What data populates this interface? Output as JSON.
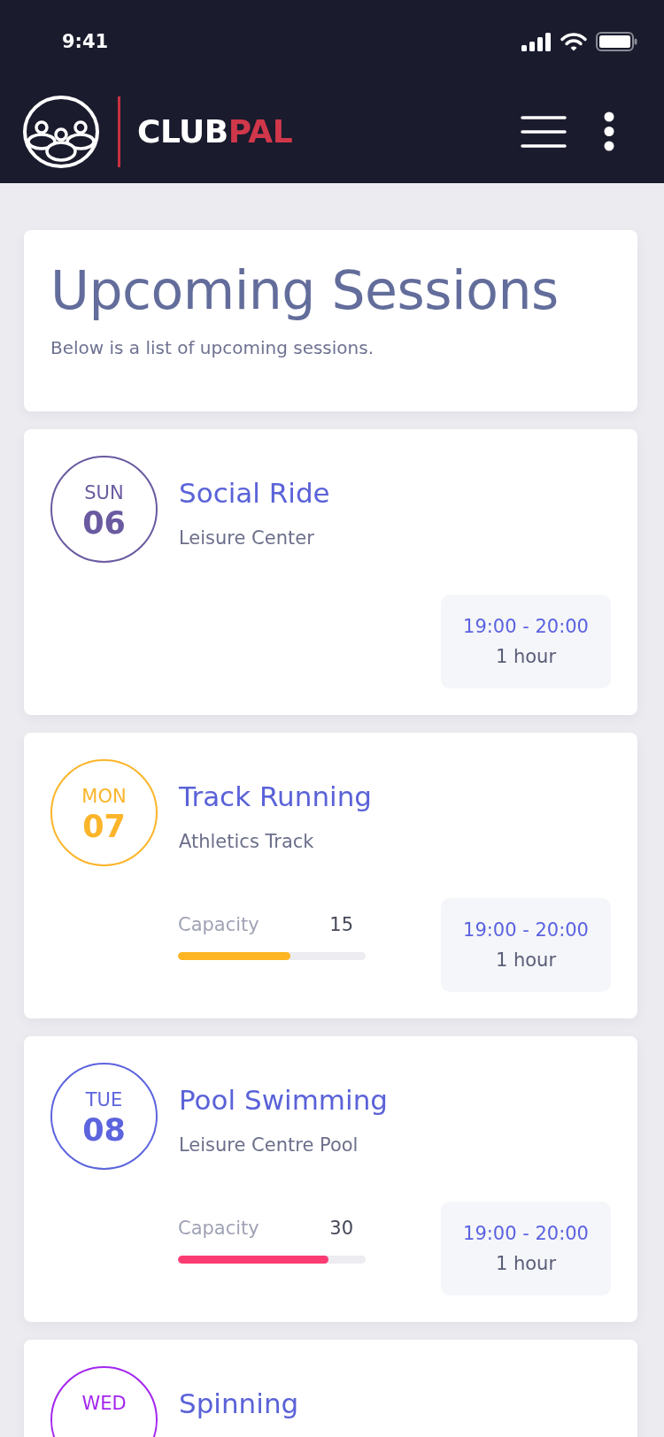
{
  "status_bar": {
    "time": "9:41"
  },
  "header": {
    "brand_main": "CLUB",
    "brand_accent": "PAL"
  },
  "page_header": {
    "title": "Upcoming Sessions",
    "subtitle": "Below is a list of upcoming sessions."
  },
  "sessions": [
    {
      "day": "SUN",
      "date": "06",
      "color": "#6a5aa0",
      "title": "Social Ride",
      "location": "Leisure Center",
      "time": "19:00 - 20:00",
      "duration": "1 hour"
    },
    {
      "day": "MON",
      "date": "07",
      "color": "#fbb52a",
      "title": "Track Running",
      "location": "Athletics Track",
      "capacity": {
        "label": "Capacity",
        "count": "15",
        "level": 0.6,
        "color": "#fdb524"
      },
      "time": "19:00 - 20:00",
      "duration": "1 hour"
    },
    {
      "day": "TUE",
      "date": "08",
      "color": "#5c64de",
      "title": "Pool Swimming",
      "location": "Leisure Centre Pool",
      "capacity": {
        "label": "Capacity",
        "count": "30",
        "level": 0.8,
        "color": "#fc3b73"
      },
      "time": "19:00 - 20:00",
      "duration": "1 hour"
    },
    {
      "day": "WED",
      "color": "#a326ee",
      "title": "Spinning"
    }
  ]
}
